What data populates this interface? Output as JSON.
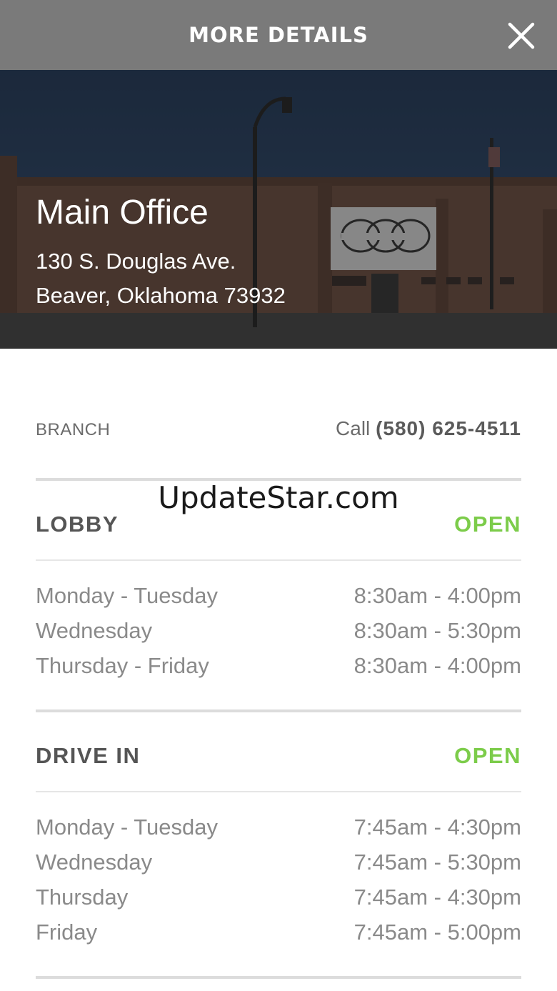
{
  "header": {
    "title": "MORE DETAILS",
    "close_icon": "close-icon"
  },
  "hero": {
    "image": "bank-building-photo",
    "title": "Main Office",
    "address_line1": "130 S. Douglas Ave.",
    "address_line2": "Beaver, Oklahoma 73932"
  },
  "branch": {
    "label": "BRANCH",
    "call_prefix": "Call",
    "phone": "(580) 625-4511"
  },
  "lobby": {
    "title": "LOBBY",
    "status": "OPEN",
    "hours": [
      {
        "day": "Monday - Tuesday",
        "time": "8:30am - 4:00pm"
      },
      {
        "day": "Wednesday",
        "time": "8:30am - 5:30pm"
      },
      {
        "day": "Thursday - Friday",
        "time": "8:30am - 4:00pm"
      }
    ]
  },
  "drive_in": {
    "title": "DRIVE IN",
    "status": "OPEN",
    "hours": [
      {
        "day": "Monday - Tuesday",
        "time": "7:45am - 4:30pm"
      },
      {
        "day": "Wednesday",
        "time": "7:45am - 5:30pm"
      },
      {
        "day": "Thursday",
        "time": "7:45am - 4:30pm"
      },
      {
        "day": "Friday",
        "time": "7:45am - 5:00pm"
      }
    ]
  },
  "watermark": "UpdateStar.com",
  "colors": {
    "header_bg": "#7a7a7a",
    "open_status": "#7ccc4a",
    "muted_text": "#8a8a8a"
  }
}
